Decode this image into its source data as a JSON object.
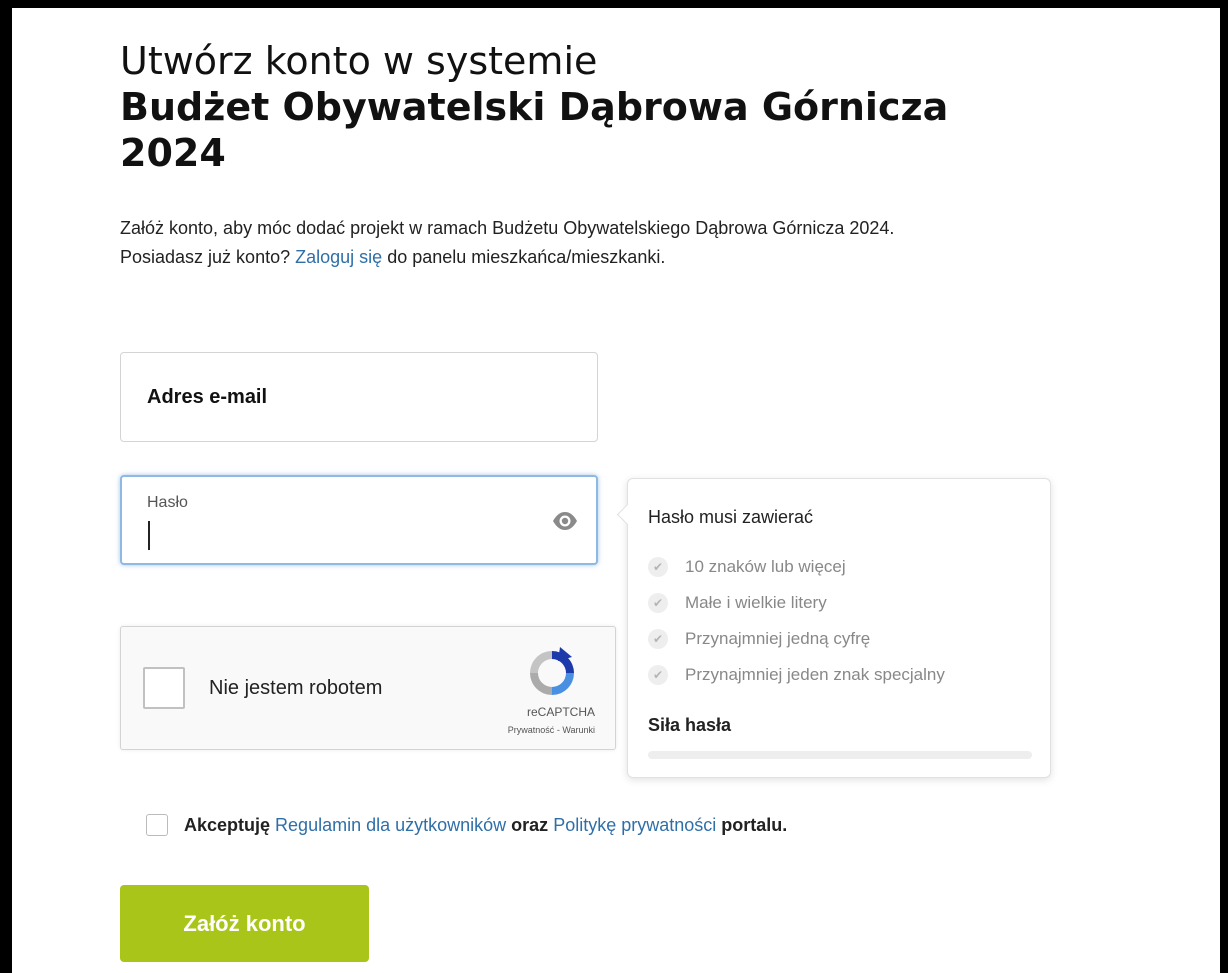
{
  "heading": {
    "line1": "Utwórz konto w systemie",
    "line2": "Budżet Obywatelski Dąbrowa Górnicza",
    "line3": "2024"
  },
  "intro": {
    "line1": "Załóż konto, aby móc dodać projekt w ramach Budżetu Obywatelskiego Dąbrowa Górnicza 2024.",
    "line2_pre": "Posiadasz już konto?",
    "login_link": "Zaloguj się",
    "line2_post": "do panelu mieszkańca/mieszkanki."
  },
  "form": {
    "email_label": "Adres e-mail",
    "password_label": "Hasło",
    "password_value": ""
  },
  "password_rules": {
    "title": "Hasło musi zawierać",
    "items": [
      "10 znaków lub więcej",
      "Małe i wielkie litery",
      "Przynajmniej jedną cyfrę",
      "Przynajmniej jeden znak specjalny"
    ],
    "strength_label": "Siła hasła",
    "strength_value": 0
  },
  "captcha": {
    "label": "Nie jestem robotem",
    "brand": "reCAPTCHA",
    "privacy": "Prywatność",
    "separator": " - ",
    "terms": "Warunki"
  },
  "terms": {
    "pre": "Akceptuję",
    "link1": "Regulamin dla użytkowników",
    "mid": "oraz",
    "link2": "Politykę prywatności",
    "post": "portalu."
  },
  "submit_label": "Załóż konto",
  "colors": {
    "accent": "#a9c51a",
    "link": "#2f6fa8",
    "focus": "#8fb9e3"
  }
}
